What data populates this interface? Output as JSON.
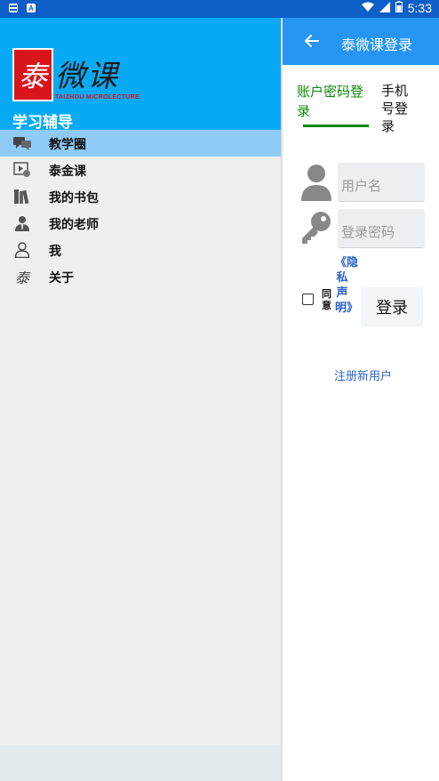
{
  "status_bar": {
    "left_icons": [
      "notification-icon",
      "a-icon"
    ],
    "right_icons": [
      "wifi-icon",
      "signal-icon",
      "battery-icon"
    ],
    "time": "5:33"
  },
  "drawer": {
    "logo": {
      "seal_char": "泰",
      "script_text": "微课",
      "subtitle": "TAIZHOU MICROLECTURE"
    },
    "title": "学习辅导",
    "items": [
      {
        "label": "教学圈",
        "icon": "chat-icon",
        "active": true
      },
      {
        "label": "泰金课",
        "icon": "video-icon",
        "active": false
      },
      {
        "label": "我的书包",
        "icon": "books-icon",
        "active": false
      },
      {
        "label": "我的老师",
        "icon": "teacher-icon",
        "active": false
      },
      {
        "label": "我",
        "icon": "person-icon",
        "active": false
      },
      {
        "label": "关于",
        "icon": "logo-mark-icon",
        "active": false
      }
    ]
  },
  "login": {
    "appbar_title": "泰微课登录",
    "tabs": {
      "account": "账户密码登录",
      "phone": "手机号登录"
    },
    "username_placeholder": "用户名",
    "password_placeholder": "登录密码",
    "agree_label": "同意",
    "privacy_link": "《隐私声明》",
    "login_button": "登录",
    "register_link": "注册新用户"
  },
  "colors": {
    "status_bar": "#0d5fc7",
    "drawer_header": "#09aaf5",
    "appbar": "#2795f3",
    "active_item": "#8fcbf6",
    "active_tab": "#0a8a0a",
    "link": "#2b63c4",
    "logo_red": "#d9151c"
  }
}
